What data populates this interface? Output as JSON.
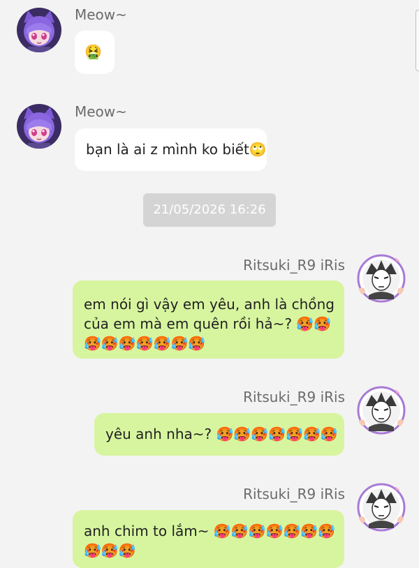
{
  "timestamp": "21/05/2026 16:26",
  "messages": [
    {
      "sender": "Meow~",
      "direction": "incoming",
      "text": "",
      "emoji": "🤮",
      "avatar_icon": "anime-catgirl-avatar"
    },
    {
      "sender": "Meow~",
      "direction": "incoming",
      "text": "bạn là ai z mình ko biết",
      "emoji": "🙄",
      "avatar_icon": "anime-catgirl-avatar"
    },
    {
      "sender": "Ritsuki_R9 iRis",
      "direction": "outgoing",
      "line1": "em nói gì vậy em yêu, anh là chồng",
      "line2": "của em mà em quên rồi hả~?",
      "line2_emoji": "🥵🥵",
      "line3_emoji": "🥵🥵🥵🥵🥵🥵🥵",
      "avatar_icon": "manga-boy-avatar"
    },
    {
      "sender": "Ritsuki_R9 iRis",
      "direction": "outgoing",
      "text": "yêu anh nha~?",
      "emoji": "🥵🥵🥵🥵🥵🥵🥵",
      "avatar_icon": "manga-boy-avatar"
    },
    {
      "sender": "Ritsuki_R9 iRis",
      "direction": "outgoing",
      "text": "anh chim to lắm~",
      "emoji": "🥵🥵🥵🥵🥵🥵🥵",
      "line2_emoji": "🥵🥵🥵",
      "avatar_icon": "manga-boy-avatar"
    }
  ],
  "colors": {
    "background": "#f3f3f3",
    "incoming_bubble": "#ffffff",
    "outgoing_bubble": "#d7f59f",
    "sender_name": "#6b6b6b",
    "timestamp_pill": "#d4d4d4"
  }
}
